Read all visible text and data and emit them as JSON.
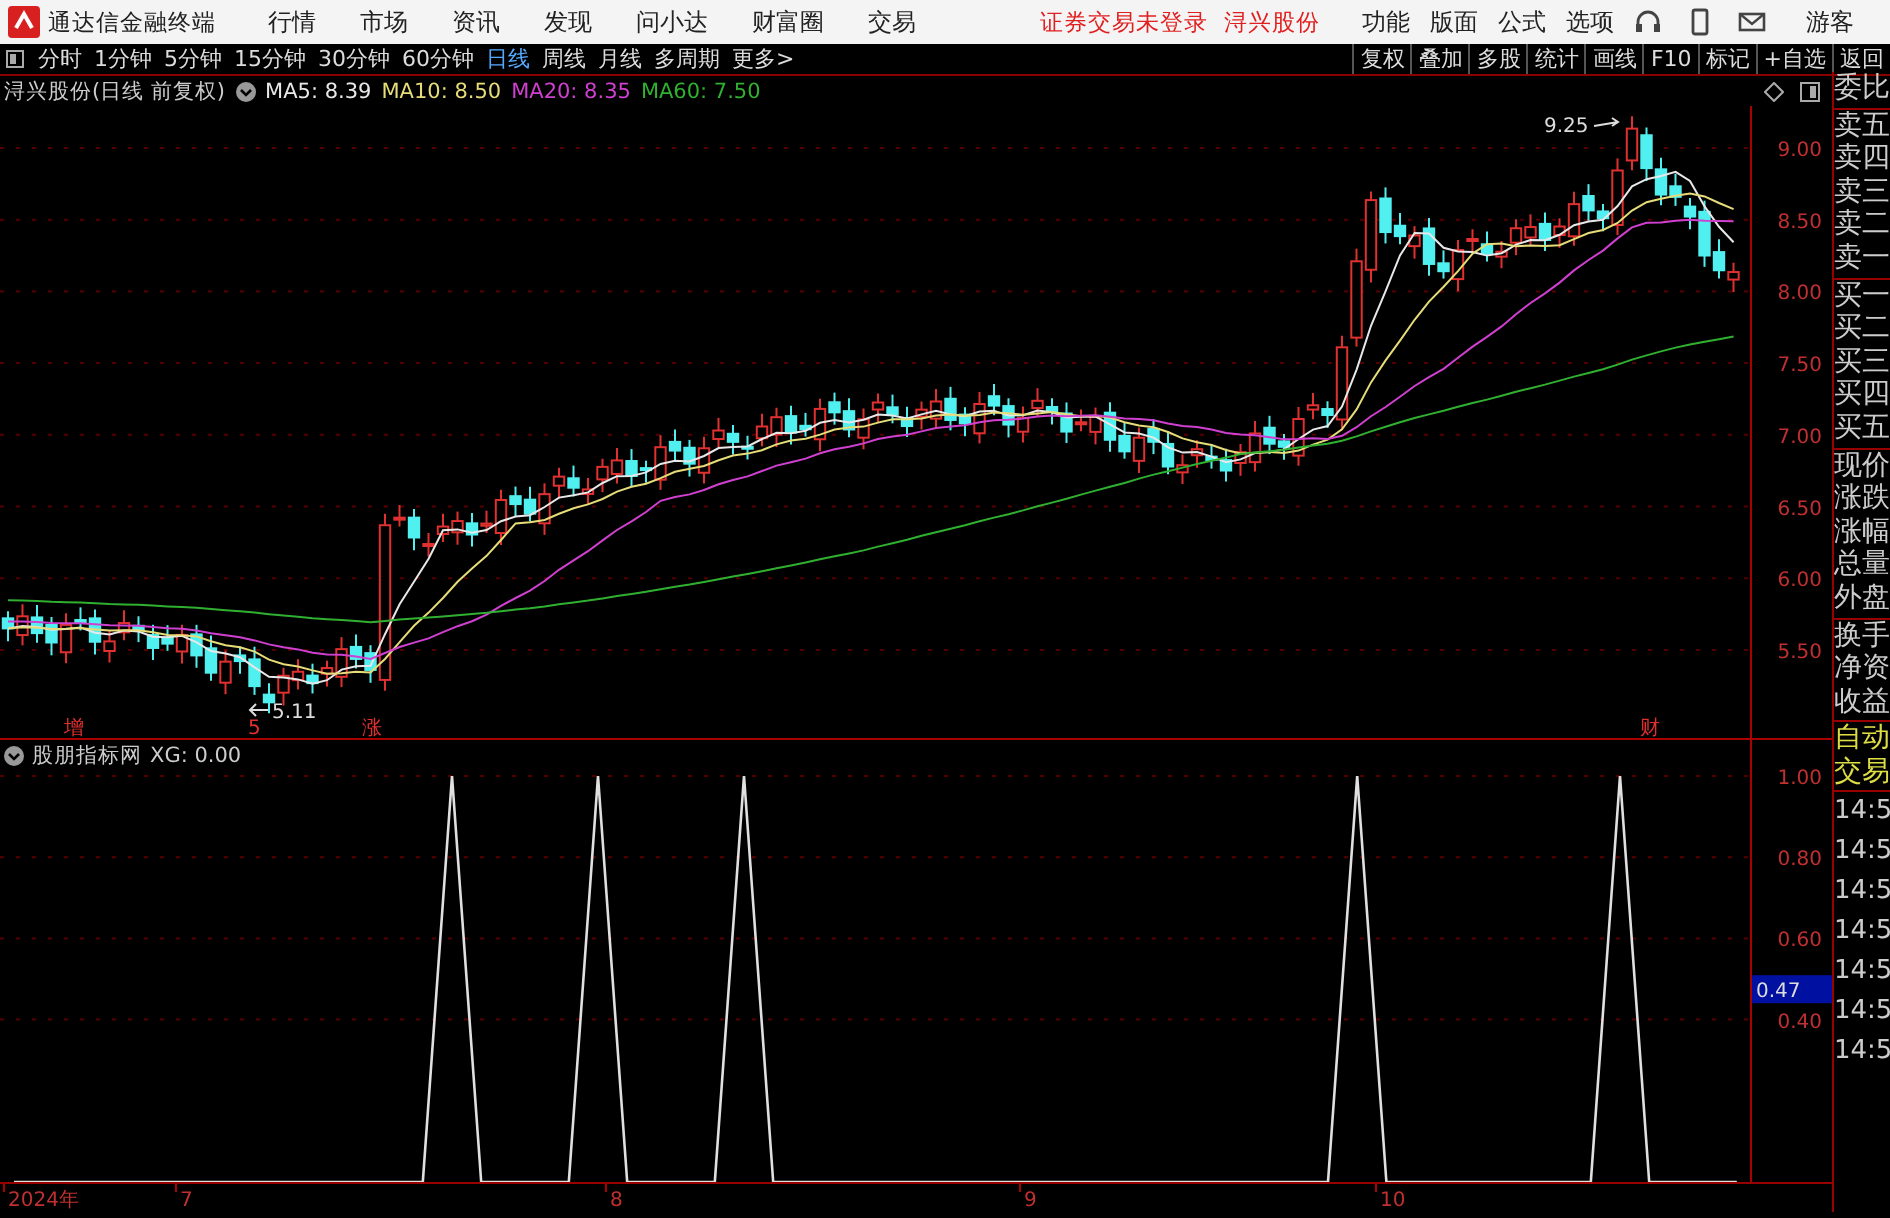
{
  "title_bar": {
    "app_name": "通达信金融终端",
    "menu": [
      "行情",
      "市场",
      "资讯",
      "发现",
      "问小达",
      "财富圈",
      "交易"
    ],
    "status": "证券交易未登录",
    "stock": "浔兴股份",
    "tools": [
      "功能",
      "版面",
      "公式",
      "选项"
    ],
    "user": "游客"
  },
  "period_tabs": [
    {
      "label": "分时",
      "selected": false
    },
    {
      "label": "1分钟",
      "selected": false
    },
    {
      "label": "5分钟",
      "selected": false
    },
    {
      "label": "15分钟",
      "selected": false
    },
    {
      "label": "30分钟",
      "selected": false
    },
    {
      "label": "60分钟",
      "selected": false
    },
    {
      "label": "日线",
      "selected": true
    },
    {
      "label": "周线",
      "selected": false
    },
    {
      "label": "月线",
      "selected": false
    },
    {
      "label": "多周期",
      "selected": false
    },
    {
      "label": "更多>",
      "selected": false
    }
  ],
  "toolbar_buttons": [
    "复权",
    "叠加",
    "多股",
    "统计",
    "画线",
    "F10",
    "标记",
    "+自选",
    "返回"
  ],
  "main_chart": {
    "title": "浔兴股份(日线 前复权)",
    "ma": [
      {
        "label": "MA5: 8.39",
        "color": "#e8e8e8"
      },
      {
        "label": "MA10: 8.50",
        "color": "#e6dc78"
      },
      {
        "label": "MA20: 8.35",
        "color": "#d040d0"
      },
      {
        "label": "MA60: 7.50",
        "color": "#30b030"
      }
    ],
    "high_label": "9.25",
    "low_label": "5.11",
    "price_ticks": [
      "9.00",
      "8.50",
      "8.00",
      "7.50",
      "7.00",
      "6.50",
      "6.00",
      "5.50"
    ],
    "markers": [
      "增",
      "5",
      "涨",
      "财"
    ]
  },
  "indicator": {
    "title": "股朋指标网",
    "reading": "XG: 0.00",
    "current": "0.47",
    "chart_data": {
      "type": "line",
      "series": [
        {
          "color": "#e0e0e0",
          "values": [
            0,
            0,
            0,
            0,
            0,
            0,
            0,
            0,
            0,
            0,
            0,
            0,
            0,
            0,
            0,
            1,
            0,
            0,
            0,
            0,
            1,
            0,
            0,
            0,
            0,
            1,
            0,
            0,
            0,
            0,
            0,
            0,
            0,
            0,
            0,
            0,
            0,
            0,
            0,
            0,
            0,
            0,
            0,
            0,
            0,
            0,
            1,
            0,
            0,
            0,
            0,
            0,
            0,
            0,
            0,
            1,
            0,
            0,
            0,
            0
          ]
        }
      ],
      "ylim": [
        0,
        1
      ],
      "grid": true,
      "yticks": [
        {
          "value": 1,
          "label": "1.00"
        },
        {
          "value": 0.8,
          "label": "0.80"
        },
        {
          "value": 0.6,
          "label": "0.60"
        },
        {
          "value": 0.4,
          "label": "0.40"
        }
      ]
    }
  },
  "date_axis": [
    "2024年",
    "7",
    "8",
    "9",
    "10"
  ],
  "sidebar": {
    "groups": [
      [
        "委比"
      ],
      [
        "卖五",
        "卖四",
        "卖三",
        "卖二",
        "卖一"
      ],
      [
        "买一",
        "买二",
        "买三",
        "买四",
        "买五"
      ],
      [
        "现价",
        "涨跌",
        "涨幅",
        "总量",
        "外盘"
      ],
      [
        "换手",
        "净资",
        "收益"
      ]
    ],
    "trade_header": [
      "自动",
      "交易"
    ],
    "trade_times": [
      "14:5",
      "14:5",
      "14:5",
      "14:5",
      "14:5",
      "14:5",
      "14:5"
    ]
  }
}
